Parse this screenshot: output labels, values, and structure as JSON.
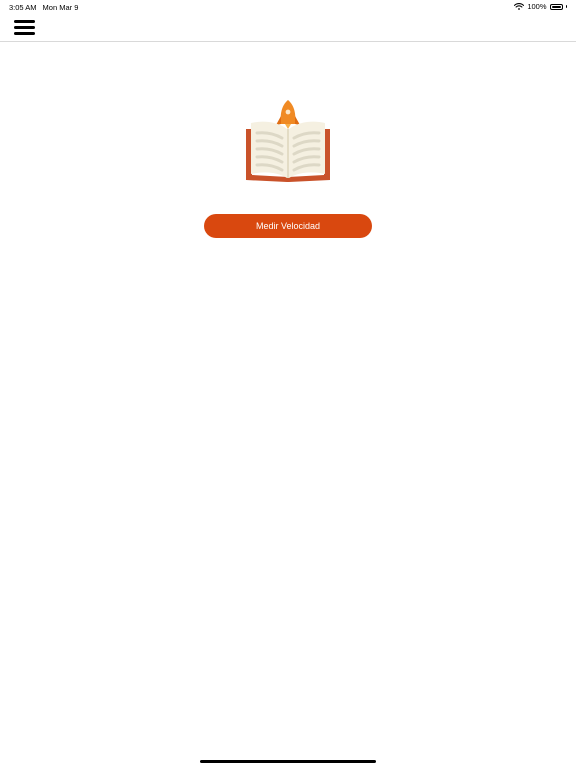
{
  "status_bar": {
    "time": "3:05 AM",
    "date": "Mon Mar 9",
    "battery": "100%",
    "wifi_icon": "wifi-icon",
    "battery_icon": "battery-icon"
  },
  "nav": {
    "menu_icon": "hamburger-menu-icon"
  },
  "hero": {
    "illustration": "open-book-rocket-illustration",
    "colors": {
      "rocket": "#f08a24",
      "book_cover": "#c9522a",
      "pages": "#f5f0e1",
      "lines": "#ddd8c6"
    }
  },
  "actions": {
    "primary_label": "Medir Velocidad",
    "primary_color": "#d9480f"
  }
}
